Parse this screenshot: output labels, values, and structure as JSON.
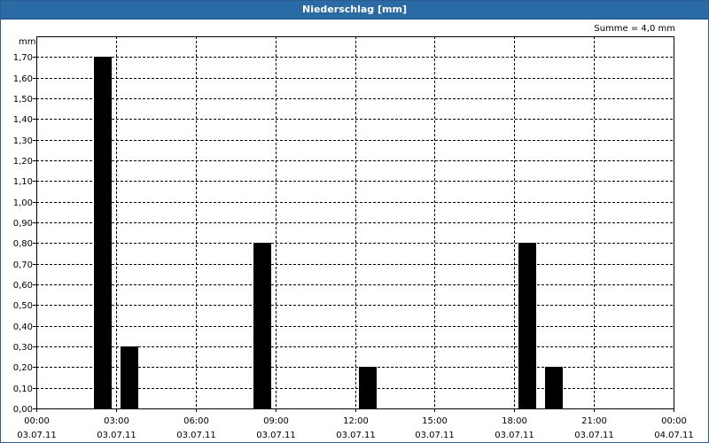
{
  "window": {
    "title": "Niederschlag [mm]"
  },
  "summary": "Summe = 4,0 mm",
  "chart_data": {
    "type": "bar",
    "title": "Niederschlag [mm]",
    "ylabel": "mm",
    "ylim": [
      0,
      1.8
    ],
    "xlim": [
      "2011-07-03T00:00",
      "2011-07-04T00:00"
    ],
    "grid": true,
    "y_ticks": [
      "0,00",
      "0,10",
      "0,20",
      "0,30",
      "0,40",
      "0,50",
      "0,60",
      "0,70",
      "0,80",
      "0,90",
      "1,00",
      "1,10",
      "1,20",
      "1,30",
      "1,40",
      "1,50",
      "1,60",
      "1,70"
    ],
    "x_ticks": [
      {
        "time": "00:00",
        "date": "03.07.11"
      },
      {
        "time": "03:00",
        "date": "03.07.11"
      },
      {
        "time": "06:00",
        "date": "03.07.11"
      },
      {
        "time": "09:00",
        "date": "03.07.11"
      },
      {
        "time": "12:00",
        "date": "03.07.11"
      },
      {
        "time": "15:00",
        "date": "03.07.11"
      },
      {
        "time": "18:00",
        "date": "03.07.11"
      },
      {
        "time": "21:00",
        "date": "03.07.11"
      },
      {
        "time": "00:00",
        "date": "04.07.11"
      }
    ],
    "bars": [
      {
        "time": "02:30",
        "value": 1.7
      },
      {
        "time": "03:30",
        "value": 0.3
      },
      {
        "time": "08:30",
        "value": 0.8
      },
      {
        "time": "12:30",
        "value": 0.2
      },
      {
        "time": "18:30",
        "value": 0.8
      },
      {
        "time": "19:30",
        "value": 0.2
      }
    ],
    "colors": {
      "bar": "#000000",
      "grid": "#000000",
      "header": "#2a6aa5"
    }
  }
}
